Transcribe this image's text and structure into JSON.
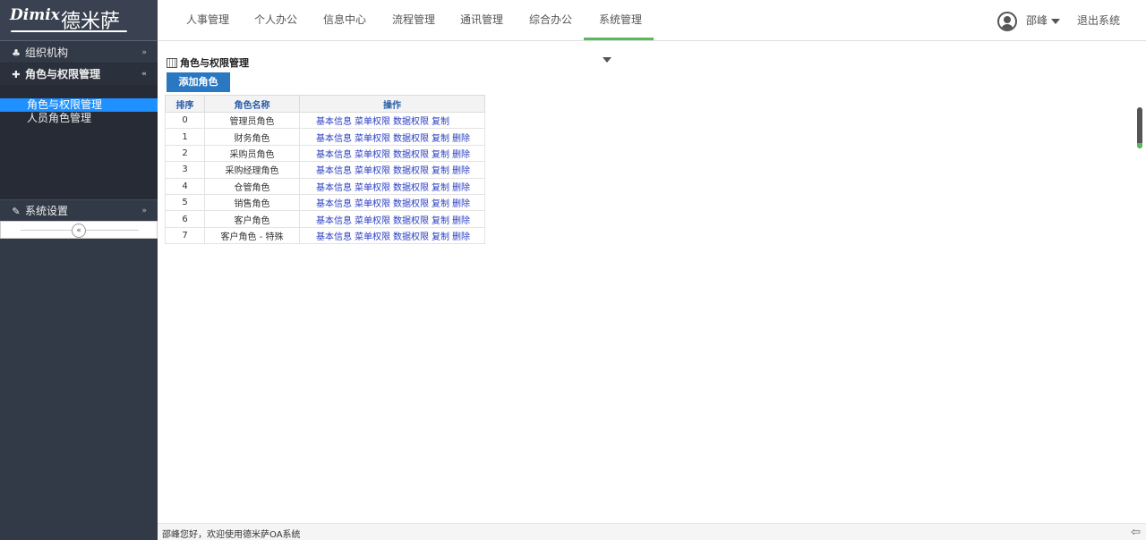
{
  "brand": {
    "latin": "Dimix",
    "chinese": "德米萨"
  },
  "sidebar": {
    "sections": [
      {
        "label": "组织机构",
        "icon": "sitemap-icon",
        "glyph": "♣",
        "chevron": "»"
      },
      {
        "label": "角色与权限管理",
        "icon": "pin-icon",
        "glyph": "✚",
        "chevron": "«"
      },
      {
        "label": "系统设置",
        "icon": "wrench-icon",
        "glyph": "✎",
        "chevron": "»"
      }
    ],
    "items": [
      {
        "label": "角色与权限管理",
        "active": true
      },
      {
        "label": "人员角色管理",
        "active": false
      }
    ],
    "collapse_glyph": "«"
  },
  "nav": {
    "items": [
      {
        "label": "人事管理"
      },
      {
        "label": "个人办公"
      },
      {
        "label": "信息中心"
      },
      {
        "label": "流程管理"
      },
      {
        "label": "通讯管理"
      },
      {
        "label": "综合办公"
      },
      {
        "label": "系统管理",
        "active": true
      }
    ],
    "user": "邵峰",
    "logout": "退出系统"
  },
  "panel": {
    "title": "角色与权限管理",
    "add_button": "添加角色"
  },
  "table": {
    "headers": [
      "排序",
      "角色名称",
      "操作"
    ],
    "rows": [
      {
        "order": "0",
        "name": "管理员角色",
        "ops": [
          "基本信息",
          "菜单权限",
          "数据权限",
          "复制"
        ]
      },
      {
        "order": "1",
        "name": "财务角色",
        "ops": [
          "基本信息",
          "菜单权限",
          "数据权限",
          "复制",
          "删除"
        ]
      },
      {
        "order": "2",
        "name": "采购员角色",
        "ops": [
          "基本信息",
          "菜单权限",
          "数据权限",
          "复制",
          "删除"
        ]
      },
      {
        "order": "3",
        "name": "采购经理角色",
        "ops": [
          "基本信息",
          "菜单权限",
          "数据权限",
          "复制",
          "删除"
        ]
      },
      {
        "order": "4",
        "name": "仓管角色",
        "ops": [
          "基本信息",
          "菜单权限",
          "数据权限",
          "复制",
          "删除"
        ]
      },
      {
        "order": "5",
        "name": "销售角色",
        "ops": [
          "基本信息",
          "菜单权限",
          "数据权限",
          "复制",
          "删除"
        ]
      },
      {
        "order": "6",
        "name": "客户角色",
        "ops": [
          "基本信息",
          "菜单权限",
          "数据权限",
          "复制",
          "删除"
        ]
      },
      {
        "order": "7",
        "name": "客户角色 - 特殊",
        "ops": [
          "基本信息",
          "菜单权限",
          "数据权限",
          "复制",
          "删除"
        ]
      }
    ]
  },
  "footer": {
    "text": "邵峰您好，欢迎使用德米萨OA系统",
    "icon": "exit-arrow-icon",
    "glyph": "⇦"
  }
}
